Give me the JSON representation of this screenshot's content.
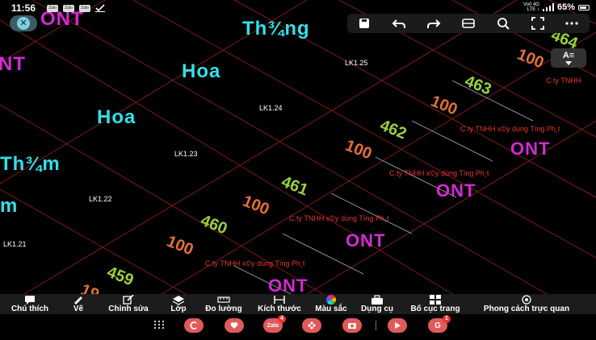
{
  "status_bar": {
    "time": "11:56",
    "notifications": [
      "Zalo",
      "Zalo",
      "Zalo"
    ],
    "network_top": "Vo0 4G",
    "network_bottom": "LTE ↕",
    "battery": "65%"
  },
  "canvas": {
    "big_labels": [
      "ONT",
      "Th¾ng",
      "NT",
      "Hoa",
      "Hoa",
      "Th¾m",
      "m"
    ],
    "lot_labels": [
      "LK1.25",
      "LK1.24",
      "LK1.23",
      "LK1.22",
      "LK1.21"
    ],
    "lot_numbers": [
      "464",
      "463",
      "462",
      "461",
      "460",
      "459",
      "19"
    ],
    "areas": [
      "100",
      "100",
      "100",
      "100",
      "100",
      "100"
    ],
    "ont_labels": [
      "ONT",
      "ONT",
      "ONT",
      "ONT"
    ],
    "company_labels": [
      "C.ty TNHH",
      "C.ty TNHH x©y dùng Tïng Ph¸t",
      "C.ty TNHH x©y dùng Tïng Ph¸t",
      "C.ty TNHH x©y dùng Tïng Ph¸t",
      "C.ty TNHH x©y dùng Tïng Ph¸t"
    ]
  },
  "top_toolbar": {
    "close_icon": "close-icon",
    "text_size_label": "A≡",
    "colors": {
      "cyan": "#33e0e6",
      "magenta": "#d22bd2",
      "green": "#9ad040",
      "orange": "#e2703a",
      "red": "#e63a30",
      "line": "#7a1d1d"
    }
  },
  "bottom_toolbar": {
    "items": [
      {
        "label": "Chú thích",
        "icon": "comment-icon"
      },
      {
        "label": "Vẽ",
        "icon": "pencil-icon"
      },
      {
        "label": "Chỉnh sửa",
        "icon": "edit-icon"
      },
      {
        "label": "Lớp",
        "icon": "layers-icon"
      },
      {
        "label": "Đo lường",
        "icon": "ruler-icon"
      },
      {
        "label": "Kích thước",
        "icon": "dimension-icon"
      },
      {
        "label": "Màu sắc",
        "icon": "color-wheel-icon"
      },
      {
        "label": "Dụng cụ",
        "icon": "toolbox-icon"
      },
      {
        "label": "Bố cục trang",
        "icon": "layout-icon"
      },
      {
        "label": "Phong cách trực quan",
        "icon": "eye-style-icon"
      }
    ]
  },
  "nav_bar": {
    "zalo_label": "Zalo",
    "zalo_badge": "4",
    "g_badge": "1"
  }
}
